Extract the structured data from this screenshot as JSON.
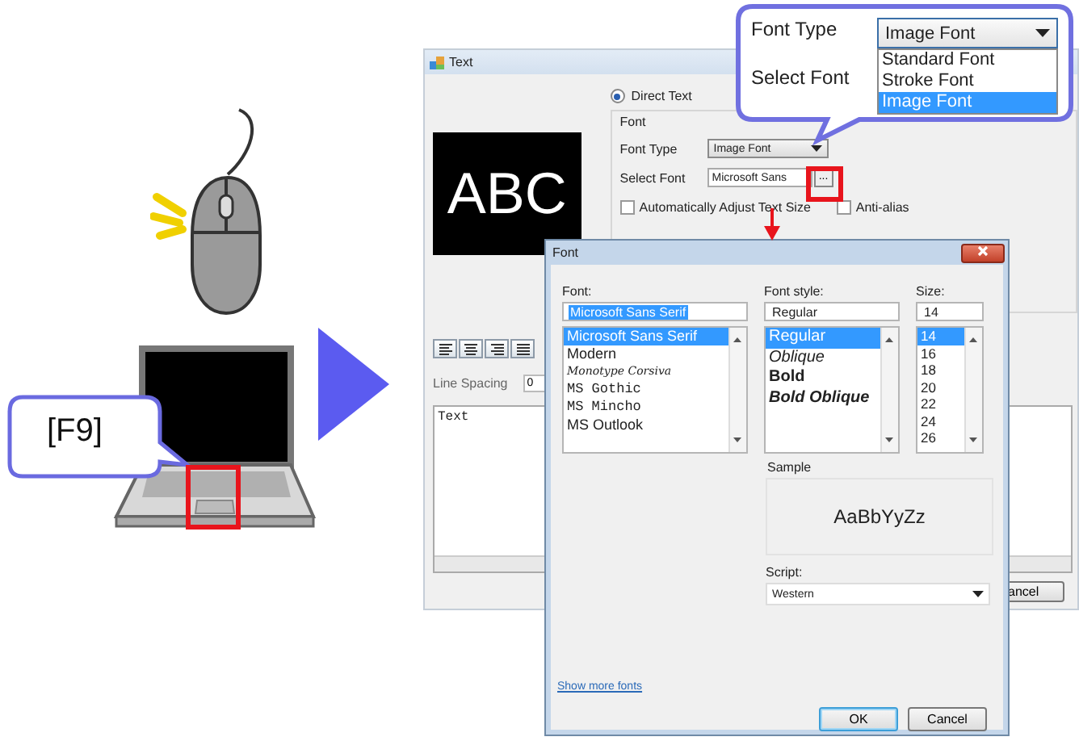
{
  "key_callout": {
    "label": "[F9]"
  },
  "text_window": {
    "title": "Text",
    "preview_text": "ABC",
    "source_options": [
      {
        "label": "Direct Text",
        "selected": true
      }
    ],
    "font_group": {
      "title": "Font",
      "font_type_label": "Font Type",
      "font_type_value": "Image Font",
      "select_font_label": "Select Font",
      "select_font_value": "Microsoft Sans",
      "browse_button": "...",
      "checkboxes": [
        {
          "label": "Automatically Adjust Text Size",
          "checked": false
        },
        {
          "label": "Anti-alias",
          "checked": false
        }
      ]
    },
    "alignment_buttons": [
      {
        "kind": "left"
      },
      {
        "kind": "center"
      },
      {
        "kind": "right"
      },
      {
        "kind": "justify"
      }
    ],
    "line_spacing_label": "Line Spacing",
    "line_spacing_value": "0",
    "text_value": "Text",
    "cancel_button": "ancel"
  },
  "font_dialog": {
    "title": "Font",
    "font_label": "Font:",
    "font_value": "Microsoft Sans Serif",
    "fonts": [
      {
        "name": "Microsoft Sans Serif",
        "kind": "sans",
        "selected": true
      },
      {
        "name": "Modern",
        "kind": "sans",
        "selected": false
      },
      {
        "name": "Monotype Corsiva",
        "kind": "script",
        "selected": false
      },
      {
        "name": "MS Gothic",
        "kind": "mono",
        "selected": false
      },
      {
        "name": "MS Mincho",
        "kind": "mono",
        "selected": false
      },
      {
        "name": "MS Outlook",
        "kind": "sans",
        "selected": false
      }
    ],
    "style_label": "Font style:",
    "style_value": "Regular",
    "styles": [
      {
        "name": "Regular",
        "kind": "regular",
        "selected": true
      },
      {
        "name": "Oblique",
        "kind": "italic",
        "selected": false
      },
      {
        "name": "Bold",
        "kind": "bold",
        "selected": false
      },
      {
        "name": "Bold Oblique",
        "kind": "bold-italic",
        "selected": false
      }
    ],
    "size_label": "Size:",
    "size_value": "14",
    "sizes": [
      {
        "name": "14",
        "selected": true
      },
      {
        "name": "16",
        "selected": false
      },
      {
        "name": "18",
        "selected": false
      },
      {
        "name": "20",
        "selected": false
      },
      {
        "name": "22",
        "selected": false
      },
      {
        "name": "24",
        "selected": false
      },
      {
        "name": "26",
        "selected": false
      }
    ],
    "sample_label": "Sample",
    "sample_text": "AaBbYyZz",
    "script_label": "Script:",
    "script_value": "Western",
    "more_fonts_link": "Show more fonts",
    "ok_button": "OK",
    "cancel_button": "Cancel"
  },
  "font_type_callout": {
    "font_type_label": "Font Type",
    "font_type_value": "Image Font",
    "options": [
      {
        "label": "Standard Font",
        "selected": false
      },
      {
        "label": "Stroke Font",
        "selected": false
      },
      {
        "label": "Image Font",
        "selected": true
      }
    ],
    "select_font_label": "Select Font"
  }
}
